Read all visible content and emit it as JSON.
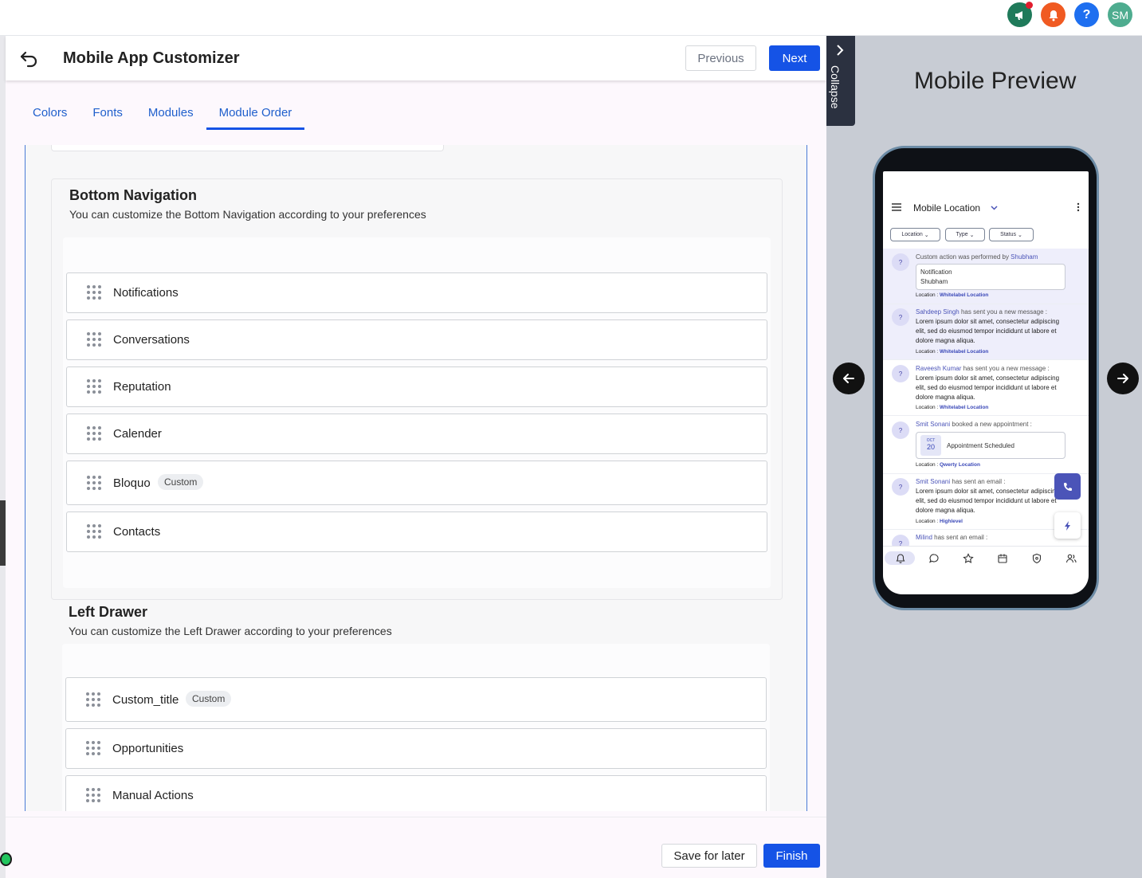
{
  "topbar": {
    "icons": [
      {
        "name": "megaphone-icon",
        "color": "#1f7a5a"
      },
      {
        "name": "bell-icon",
        "color": "#f05a22"
      },
      {
        "name": "help-icon",
        "color": "#1e6ff0",
        "glyph": "?"
      },
      {
        "name": "avatar",
        "color": "#4eac8f",
        "initials": "SM"
      }
    ]
  },
  "header": {
    "title": "Mobile App Customizer",
    "previous_label": "Previous",
    "next_label": "Next"
  },
  "tabs": [
    {
      "label": "Colors"
    },
    {
      "label": "Fonts"
    },
    {
      "label": "Modules"
    },
    {
      "label": "Module Order",
      "active": true
    }
  ],
  "bottom_navigation": {
    "title": "Bottom Navigation",
    "description": "You can customize the Bottom Navigation according to your preferences",
    "items": [
      {
        "label": "Notifications"
      },
      {
        "label": "Conversations"
      },
      {
        "label": "Reputation"
      },
      {
        "label": "Calender"
      },
      {
        "label": "Bloquo",
        "badge": "Custom"
      },
      {
        "label": "Contacts"
      }
    ]
  },
  "left_drawer": {
    "title": "Left Drawer",
    "description": "You can customize the Left Drawer according to your preferences",
    "items": [
      {
        "label": "Custom_title",
        "badge": "Custom"
      },
      {
        "label": "Opportunities"
      },
      {
        "label": "Manual Actions"
      }
    ]
  },
  "footer": {
    "save_label": "Save for later",
    "finish_label": "Finish"
  },
  "preview": {
    "collapse_label": "Collapse",
    "title": "Mobile Preview",
    "phone": {
      "location_title": "Mobile Location",
      "filters": [
        "Location",
        "Type",
        "Status"
      ],
      "feed": [
        {
          "text": "Custom action was performed by ",
          "name": "Shubham",
          "box": [
            "Notification",
            "Shubham"
          ],
          "location_label": "Location : ",
          "location": "Whitelabel Location"
        },
        {
          "name": "Sahdeep Singh",
          "text": " has sent you a new message :",
          "body": "Lorem ipsum dolor sit amet, consectetur adipiscing elit, sed do eiusmod tempor incididunt ut labore et dolore magna aliqua.",
          "location_label": "Location : ",
          "location": "Whitelabel Location"
        },
        {
          "name": "Raveesh Kumar",
          "text": " has sent you a new message :",
          "body": "Lorem ipsum dolor sit amet, consectetur adipiscing elit, sed do eiusmod tempor incididunt ut labore et dolore magna aliqua.",
          "location_label": "Location : ",
          "location": "Whitelabel Location"
        },
        {
          "name": "Smit Sonani",
          "text": " booked a new appointment :",
          "month": "OCT",
          "day": "20",
          "appointment": "Appointment Scheduled",
          "location_label": "Location : ",
          "location": "Qwerty Location"
        },
        {
          "name": "Smit Sonani",
          "text": " has sent an email :",
          "body": "Lorem ipsum dolor sit amet, consectetur adipiscing elit, sed do eiusmod tempor incididunt ut labore et dolore magna aliqua.",
          "location_label": "Location : ",
          "location": "Highlevel"
        },
        {
          "name": "Milind",
          "text": " has sent an email :"
        }
      ],
      "avatar_glyph": "?",
      "colors": {
        "accent": "#4b54b8",
        "highlight": "#eeeefb"
      }
    }
  },
  "colors": {
    "primary": "#1553e6",
    "tab_text": "#1f5fcc"
  }
}
